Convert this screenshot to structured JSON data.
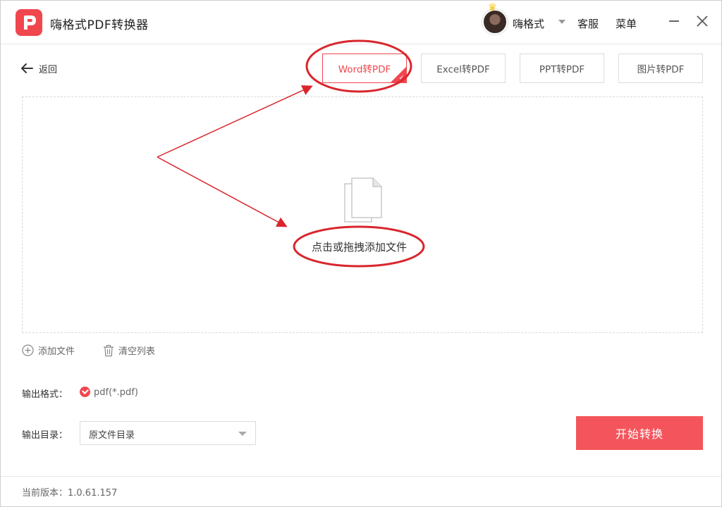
{
  "app": {
    "title": "嗨格式PDF转换器",
    "username": "嗨格式",
    "service": "客服",
    "menu": "菜单"
  },
  "toolbar": {
    "back_label": "返回",
    "tabs": [
      {
        "label": "Word转PDF",
        "active": true
      },
      {
        "label": "Excel转PDF",
        "active": false
      },
      {
        "label": "PPT转PDF",
        "active": false
      },
      {
        "label": "图片转PDF",
        "active": false
      }
    ]
  },
  "dropzone": {
    "hint": "点击或拖拽添加文件"
  },
  "file_actions": {
    "add_label": "添加文件",
    "clear_label": "清空列表"
  },
  "output": {
    "format_label": "输出格式：",
    "format_value": "pdf(*.pdf)",
    "dir_label": "输出目录：",
    "dir_value": "原文件目录"
  },
  "start_button": "开始转换",
  "footer": {
    "version_label": "当前版本：1.0.61.157"
  },
  "colors": {
    "accent": "#f0474f",
    "annotation": "#d9262c"
  },
  "icons": {
    "logo": "pdf-logo-icon",
    "back": "arrow-left-icon",
    "add": "plus-circle-icon",
    "clear": "trash-icon",
    "file": "document-icon"
  }
}
